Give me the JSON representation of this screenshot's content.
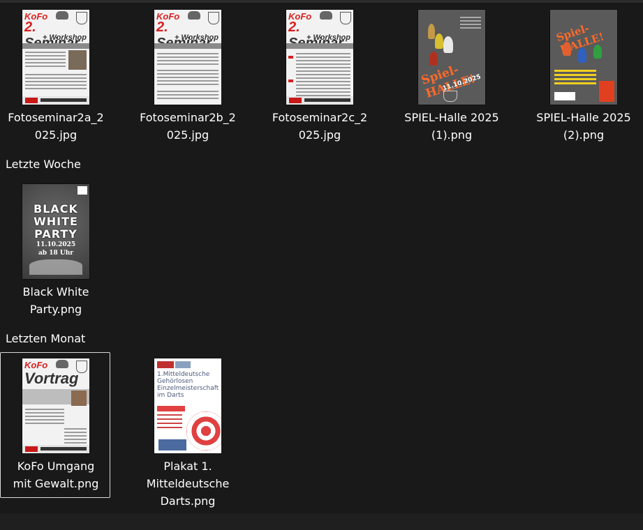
{
  "groups": {
    "last_week": "Letzte Woche",
    "last_month": "Letzten Monat"
  },
  "files": [
    {
      "name": "Fotoseminar2a_2025.jpg",
      "label_lines": [
        "Fotoseminar2a_2",
        "025.jpg"
      ]
    },
    {
      "name": "Fotoseminar2b_2025.jpg",
      "label_lines": [
        "Fotoseminar2b_2",
        "025.jpg"
      ]
    },
    {
      "name": "Fotoseminar2c_2025.jpg",
      "label_lines": [
        "Fotoseminar2c_2",
        "025.jpg"
      ]
    },
    {
      "name": "SPIEL-Halle 2025 (1).png",
      "label_lines": [
        "SPIEL-Halle 2025",
        "(1).png"
      ]
    },
    {
      "name": "SPIEL-Halle 2025 (2).png",
      "label_lines": [
        "SPIEL-Halle 2025",
        "(2).png"
      ]
    },
    {
      "name": "Black White Party.png",
      "label_lines": [
        "Black White",
        "Party.png"
      ]
    },
    {
      "name": "KoFo Umgang mit Gewalt.png",
      "label_lines": [
        "KoFo Umgang",
        "mit Gewalt.png"
      ],
      "selected": true
    },
    {
      "name": "Plakat 1. Mitteldeutsche Darts.png",
      "label_lines": [
        "Plakat 1.",
        "Mitteldeutsche",
        "Darts.png"
      ]
    }
  ],
  "thumb_text": {
    "kofo_logo": "KoFo",
    "seminar_num": "2.",
    "seminar_word": "Seminar",
    "workshop": "+ Workshop",
    "vortrag": "Vortrag",
    "spiel_title": "Spiel-HALLE!",
    "spiel_date": "11.10.2025",
    "bw_black": "BLACK",
    "bw_white": "WHITE",
    "bw_party": "PARTY",
    "bw_date": "11.10.2025",
    "bw_time": "ab 18 Uhr",
    "darts_title": "1.Mitteldeutsche Gehörlosen Einzelmeisterschaft im Darts"
  },
  "colors": {
    "background": "#191919",
    "selection_border": "#d9d9d9",
    "kofo_red": "#d82020",
    "spiel_orange": "#ff6a2a"
  }
}
